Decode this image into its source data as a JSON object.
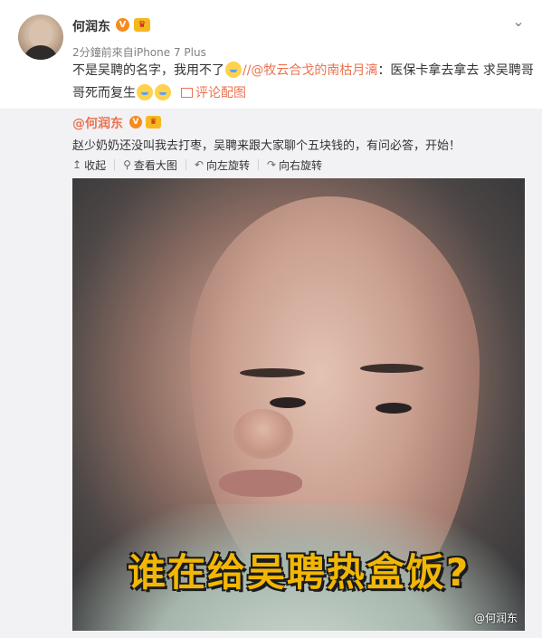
{
  "post": {
    "username": "何润东",
    "badge_v": "V",
    "badge_crown": "♛",
    "menu_icon": "chevron-down-icon",
    "meta": "2分鐘前來自iPhone 7 Plus",
    "text_part1": "不是吴聘的名字，我用不了",
    "text_link": "//@牧云合戈的南枯月漓",
    "text_part2": "：医保卡拿去拿去 求吴聘哥哥死而复生",
    "pic_link": "评论配图"
  },
  "repost": {
    "username": "@何润东",
    "badge_v": "V",
    "badge_crown": "♛",
    "text": "赵少奶奶还没叫我去打枣，吴聘来跟大家聊个五块钱的，有问必答，开始！",
    "tools": [
      {
        "icon": "↥",
        "label": "收起"
      },
      {
        "icon": "⚲",
        "label": "查看大图"
      },
      {
        "icon": "↶",
        "label": "向左旋转"
      },
      {
        "icon": "↷",
        "label": "向右旋转"
      }
    ]
  },
  "photo": {
    "caption": "谁在给吴聘热盒饭?",
    "watermark": "@何润东"
  },
  "colors": {
    "link": "#eb7350",
    "caption": "#f2b705",
    "repost_bg": "#f2f2f5"
  }
}
